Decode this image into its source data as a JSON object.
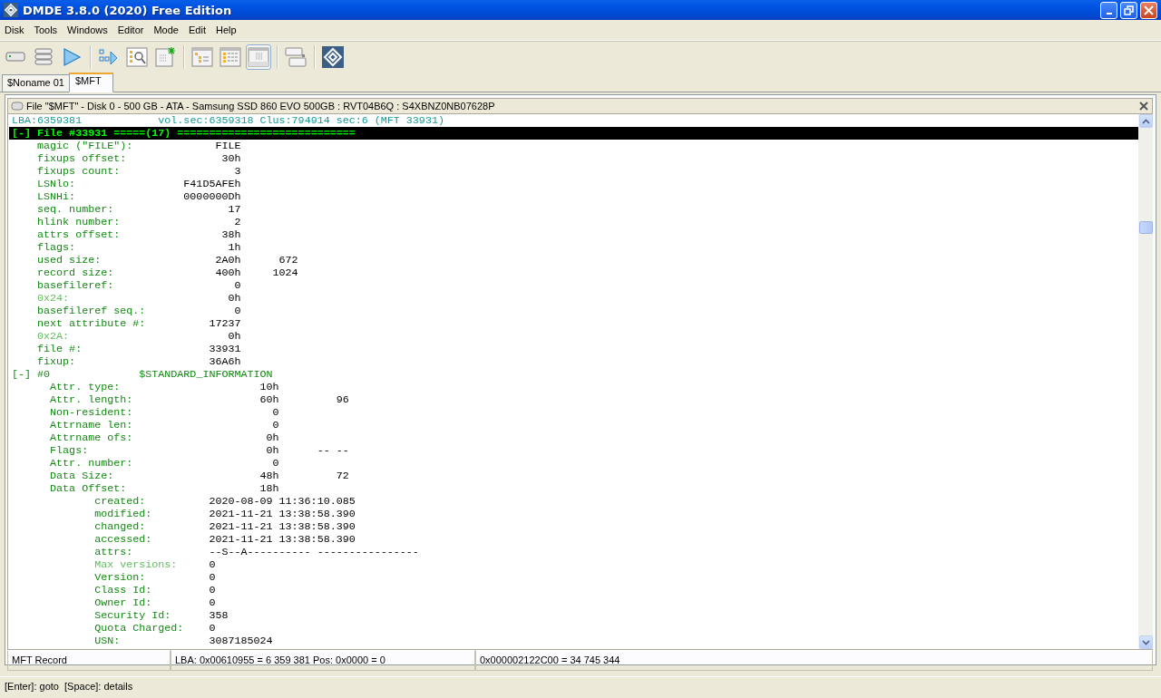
{
  "window": {
    "title": "DMDE 3.8.0 (2020) Free Edition"
  },
  "menu": [
    "Disk",
    "Tools",
    "Windows",
    "Editor",
    "Mode",
    "Edit",
    "Help"
  ],
  "toolbar": [
    {
      "kind": "drive",
      "selected": false
    },
    {
      "kind": "stack",
      "selected": false
    },
    {
      "kind": "play",
      "selected": false
    },
    {
      "kind": "sep"
    },
    {
      "kind": "flow",
      "selected": false
    },
    {
      "kind": "search",
      "selected": false
    },
    {
      "kind": "newfile",
      "selected": false
    },
    {
      "kind": "sep"
    },
    {
      "kind": "tree",
      "selected": false
    },
    {
      "kind": "list",
      "selected": false
    },
    {
      "kind": "grid",
      "selected": true
    },
    {
      "kind": "sep"
    },
    {
      "kind": "panels",
      "selected": false
    },
    {
      "kind": "sep"
    },
    {
      "kind": "logo",
      "selected": false
    }
  ],
  "tabs": [
    {
      "label": "$Noname 01",
      "selected": false
    },
    {
      "label": "$MFT",
      "selected": true
    }
  ],
  "panel": {
    "title": "File \"$MFT\" - Disk 0 - 500 GB - ATA - Samsung SSD 860 EVO 500GB : RVT04B6Q : S4XBNZ0NB07628P",
    "position": {
      "lba": "LBA:6359381",
      "location": "vol.sec:6359318 Clus:794914 sec:6 (MFT 33931)"
    },
    "rows": [
      {
        "kind": "heading",
        "label": "[-] File #33931 =====(17) ============================"
      },
      {
        "kind": "field",
        "label": "magic (\"FILE\"):",
        "value": "FILE",
        "dim": false
      },
      {
        "kind": "field",
        "label": "fixups offset:",
        "value": "30h",
        "dim": false
      },
      {
        "kind": "field",
        "label": "fixups count:",
        "value": "3",
        "dim": false
      },
      {
        "kind": "field",
        "label": "LSNlo:",
        "value": "F41D5AFEh",
        "dim": false
      },
      {
        "kind": "field",
        "label": "LSNHi:",
        "value": "0000000Dh",
        "dim": false
      },
      {
        "kind": "field",
        "label": "seq. number:",
        "value": "17",
        "dim": false
      },
      {
        "kind": "field",
        "label": "hlink number:",
        "value": "2",
        "dim": false
      },
      {
        "kind": "field",
        "label": "attrs offset:",
        "value": "38h",
        "dim": false
      },
      {
        "kind": "field",
        "label": "flags:",
        "value": "1h",
        "dim": false
      },
      {
        "kind": "field",
        "label": "used size:",
        "value": "2A0h",
        "extra": "672",
        "dim": false
      },
      {
        "kind": "field",
        "label": "record size:",
        "value": "400h",
        "extra": "1024",
        "dim": false
      },
      {
        "kind": "field",
        "label": "basefileref:",
        "value": "0",
        "dim": false
      },
      {
        "kind": "field",
        "label": "0x24:",
        "value": "0h",
        "dim": true
      },
      {
        "kind": "field",
        "label": "basefileref seq.:",
        "value": "0",
        "dim": false
      },
      {
        "kind": "field",
        "label": "next attribute #:",
        "value": "17237",
        "dim": false
      },
      {
        "kind": "field",
        "label": "0x2A:",
        "value": "0h",
        "dim": true
      },
      {
        "kind": "field",
        "label": "file #:",
        "value": "33931",
        "dim": false
      },
      {
        "kind": "field",
        "label": "fixup:",
        "value": "36A6h",
        "dim": false
      },
      {
        "kind": "attribute",
        "label": "[-] #0",
        "name": "$STANDARD_INFORMATION"
      },
      {
        "kind": "attr",
        "label": "Attr. type:",
        "value": "10h",
        "dim": false
      },
      {
        "kind": "attr",
        "label": "Attr. length:",
        "value": "60h",
        "extra": "96",
        "dim": false
      },
      {
        "kind": "attr",
        "label": "Non-resident:",
        "value": "0",
        "dim": false
      },
      {
        "kind": "attr",
        "label": "Attrname len:",
        "value": "0",
        "dim": false
      },
      {
        "kind": "attr",
        "label": "Attrname ofs:",
        "value": "0h",
        "dim": false
      },
      {
        "kind": "attr",
        "label": "Flags:",
        "value": "0h",
        "extra": "-- --",
        "dim": false
      },
      {
        "kind": "attr",
        "label": "Attr. number:",
        "value": "0",
        "dim": false
      },
      {
        "kind": "attr",
        "label": "Data Size:",
        "value": "48h",
        "extra": "72",
        "dim": false
      },
      {
        "kind": "attr",
        "label": "Data Offset:",
        "value": "18h",
        "dim": false
      },
      {
        "kind": "time",
        "label": "created:",
        "value": "2020-08-09 11:36:10.085",
        "dim": false
      },
      {
        "kind": "time",
        "label": "modified:",
        "value": "2021-11-21 13:38:58.390",
        "dim": false
      },
      {
        "kind": "time",
        "label": "changed:",
        "value": "2021-11-21 13:38:58.390",
        "dim": false
      },
      {
        "kind": "time",
        "label": "accessed:",
        "value": "2021-11-21 13:38:58.390",
        "dim": false
      },
      {
        "kind": "time",
        "label": "attrs:",
        "value": "--S--A----------",
        "extra": "----------------",
        "dim": false
      },
      {
        "kind": "time",
        "label": "Max versions:",
        "value": "0",
        "dim": true
      },
      {
        "kind": "time",
        "label": "Version:",
        "value": "0",
        "dim": false
      },
      {
        "kind": "time",
        "label": "Class Id:",
        "value": "0",
        "dim": false
      },
      {
        "kind": "time",
        "label": "Owner Id:",
        "value": "0",
        "dim": false
      },
      {
        "kind": "time",
        "label": "Security Id:",
        "value": "358",
        "dim": false
      },
      {
        "kind": "time",
        "label": "Quota Charged:",
        "value": "0",
        "dim": false
      },
      {
        "kind": "time",
        "label": "USN:",
        "value": "3087185024",
        "dim": false
      }
    ]
  },
  "status_bar": [
    "MFT Record",
    "LBA: 0x00610955 = 6 359 381  Pos: 0x0000 = 0",
    "0x000002122C00 = 34 745 344"
  ],
  "hint": "[Enter]: goto  [Space]: details"
}
